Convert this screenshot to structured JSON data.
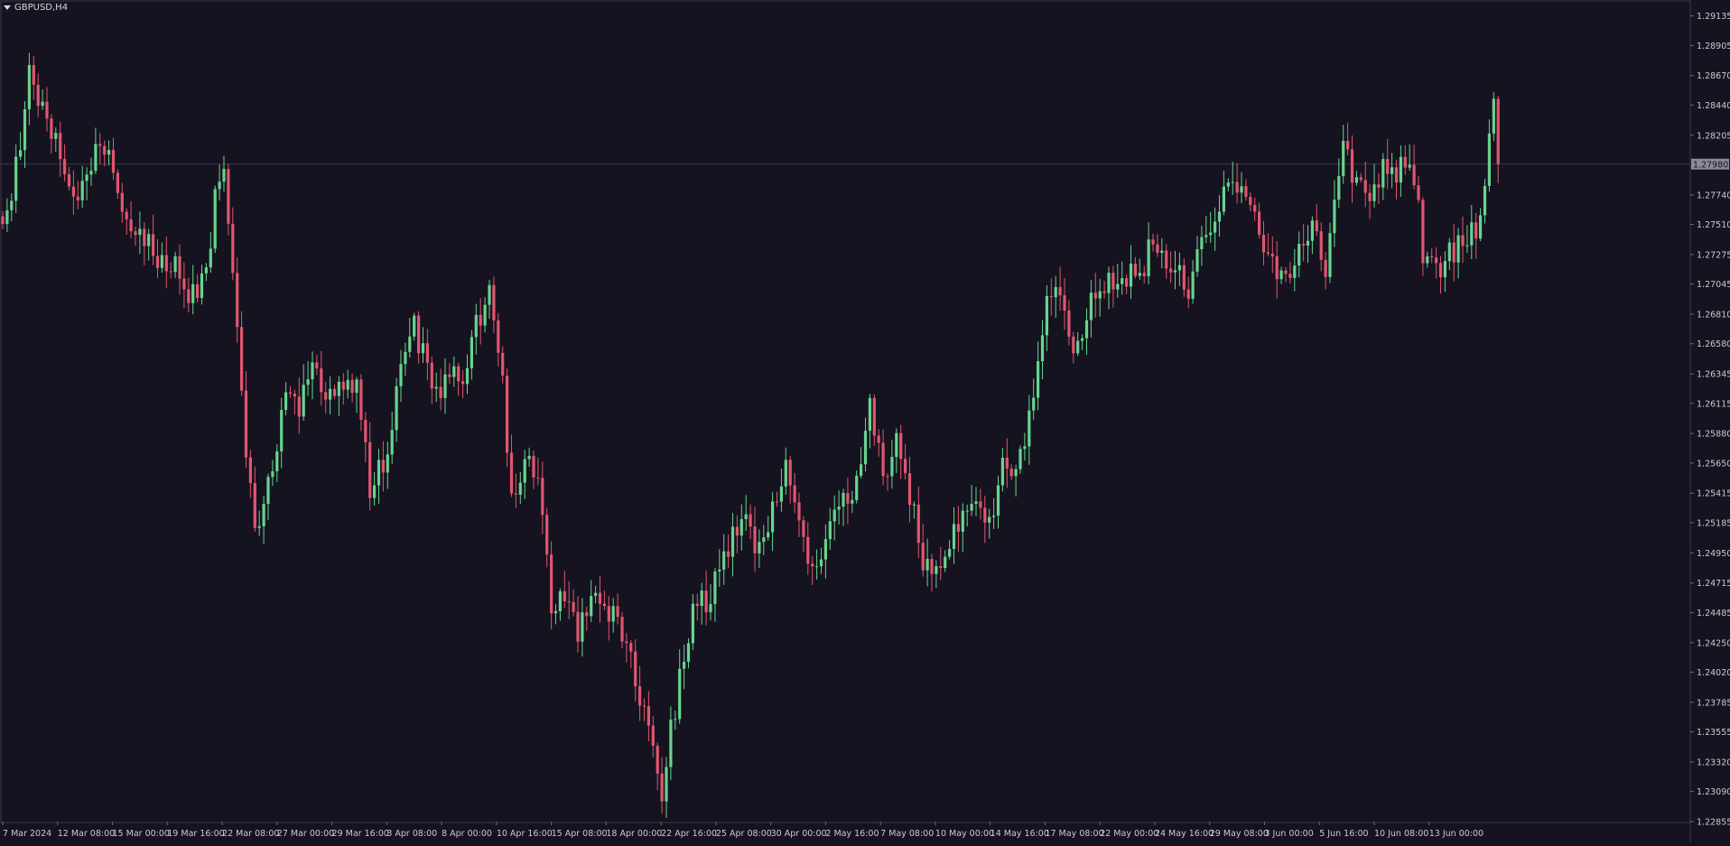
{
  "window": {
    "symbol": "GBPUSD,H4"
  },
  "chart_data": {
    "type": "candlestick",
    "symbol": "GBPUSD",
    "timeframe": "H4",
    "ylim": [
      1.22855,
      1.29245
    ],
    "y_ticks": [
      "1.29135",
      "1.28905",
      "1.28670",
      "1.28440",
      "1.28205",
      "1.27740",
      "1.27510",
      "1.27275",
      "1.27045",
      "1.26810",
      "1.26580",
      "1.26345",
      "1.26115",
      "1.25880",
      "1.25650",
      "1.25415",
      "1.25185",
      "1.24950",
      "1.24715",
      "1.24485",
      "1.24250",
      "1.24020",
      "1.23785",
      "1.23555",
      "1.23320",
      "1.23090",
      "1.22855"
    ],
    "x_ticks": [
      "7 Mar 2024",
      "12 Mar 08:00",
      "15 Mar 00:00",
      "19 Mar 16:00",
      "22 Mar 08:00",
      "27 Mar 00:00",
      "29 Mar 16:00",
      "3 Apr 08:00",
      "8 Apr 00:00",
      "10 Apr 16:00",
      "15 Apr 08:00",
      "18 Apr 00:00",
      "22 Apr 16:00",
      "25 Apr 08:00",
      "30 Apr 00:00",
      "2 May 16:00",
      "7 May 08:00",
      "10 May 00:00",
      "14 May 16:00",
      "17 May 08:00",
      "22 May 00:00",
      "24 May 16:00",
      "29 May 08:00",
      "3 Jun 00:00",
      "5 Jun 16:00",
      "10 Jun 08:00",
      "13 Jun 00:00"
    ],
    "current_price": "1.27980",
    "current_price_value": 1.2798,
    "candle_count": 339,
    "bull_color": "#67d48d",
    "bear_color": "#e0566f",
    "background": "#161320",
    "grid": false,
    "price_path": [
      [
        0,
        1.2745
      ],
      [
        4,
        1.2812
      ],
      [
        6,
        1.2865
      ],
      [
        9,
        1.2843
      ],
      [
        13,
        1.2805
      ],
      [
        16,
        1.277
      ],
      [
        20,
        1.2802
      ],
      [
        24,
        1.2818
      ],
      [
        26,
        1.2778
      ],
      [
        30,
        1.274
      ],
      [
        35,
        1.2728
      ],
      [
        40,
        1.2712
      ],
      [
        42,
        1.269
      ],
      [
        46,
        1.2708
      ],
      [
        48,
        1.2778
      ],
      [
        50,
        1.2788
      ],
      [
        52,
        1.2705
      ],
      [
        55,
        1.258
      ],
      [
        57,
        1.2505
      ],
      [
        60,
        1.2545
      ],
      [
        64,
        1.2625
      ],
      [
        67,
        1.2612
      ],
      [
        70,
        1.2638
      ],
      [
        73,
        1.261
      ],
      [
        76,
        1.2635
      ],
      [
        80,
        1.2625
      ],
      [
        83,
        1.2545
      ],
      [
        87,
        1.257
      ],
      [
        90,
        1.265
      ],
      [
        93,
        1.267
      ],
      [
        96,
        1.264
      ],
      [
        99,
        1.2615
      ],
      [
        102,
        1.2645
      ],
      [
        104,
        1.263
      ],
      [
        106,
        1.2665
      ],
      [
        108,
        1.268
      ],
      [
        110,
        1.2695
      ],
      [
        113,
        1.2625
      ],
      [
        115,
        1.254
      ],
      [
        118,
        1.257
      ],
      [
        121,
        1.255
      ],
      [
        124,
        1.245
      ],
      [
        127,
        1.246
      ],
      [
        130,
        1.243
      ],
      [
        133,
        1.247
      ],
      [
        136,
        1.246
      ],
      [
        139,
        1.2435
      ],
      [
        141,
        1.242
      ],
      [
        144,
        1.2385
      ],
      [
        147,
        1.2338
      ],
      [
        149,
        1.231
      ],
      [
        151,
        1.2355
      ],
      [
        153,
        1.2395
      ],
      [
        156,
        1.2455
      ],
      [
        159,
        1.2455
      ],
      [
        162,
        1.2485
      ],
      [
        165,
        1.2505
      ],
      [
        168,
        1.252
      ],
      [
        171,
        1.2495
      ],
      [
        174,
        1.2535
      ],
      [
        177,
        1.2558
      ],
      [
        179,
        1.2545
      ],
      [
        182,
        1.249
      ],
      [
        185,
        1.2482
      ],
      [
        188,
        1.2525
      ],
      [
        191,
        1.254
      ],
      [
        194,
        1.2555
      ],
      [
        196,
        1.2605
      ],
      [
        199,
        1.2555
      ],
      [
        202,
        1.258
      ],
      [
        205,
        1.254
      ],
      [
        208,
        1.2485
      ],
      [
        211,
        1.249
      ],
      [
        214,
        1.25
      ],
      [
        217,
        1.2525
      ],
      [
        220,
        1.2535
      ],
      [
        223,
        1.252
      ],
      [
        226,
        1.256
      ],
      [
        229,
        1.2558
      ],
      [
        232,
        1.2595
      ],
      [
        234,
        1.264
      ],
      [
        236,
        1.269
      ],
      [
        238,
        1.27
      ],
      [
        240,
        1.2678
      ],
      [
        242,
        1.266
      ],
      [
        244,
        1.2652
      ],
      [
        246,
        1.27
      ],
      [
        249,
        1.2708
      ],
      [
        252,
        1.2705
      ],
      [
        255,
        1.2715
      ],
      [
        258,
        1.2718
      ],
      [
        260,
        1.274
      ],
      [
        263,
        1.2725
      ],
      [
        266,
        1.2712
      ],
      [
        268,
        1.27
      ],
      [
        270,
        1.273
      ],
      [
        273,
        1.2755
      ],
      [
        276,
        1.277
      ],
      [
        278,
        1.279
      ],
      [
        280,
        1.2778
      ],
      [
        283,
        1.2755
      ],
      [
        286,
        1.273
      ],
      [
        288,
        1.2705
      ],
      [
        290,
        1.2708
      ],
      [
        293,
        1.2728
      ],
      [
        296,
        1.2752
      ],
      [
        299,
        1.272
      ],
      [
        301,
        1.276
      ],
      [
        303,
        1.2812
      ],
      [
        306,
        1.2778
      ],
      [
        309,
        1.277
      ],
      [
        312,
        1.2795
      ],
      [
        315,
        1.279
      ],
      [
        317,
        1.2805
      ],
      [
        319,
        1.279
      ],
      [
        321,
        1.273
      ],
      [
        324,
        1.2715
      ],
      [
        327,
        1.2728
      ],
      [
        330,
        1.2738
      ],
      [
        333,
        1.2748
      ],
      [
        335,
        1.2785
      ],
      [
        337,
        1.2855
      ],
      [
        339,
        1.28
      ],
      [
        341,
        1.2793
      ]
    ]
  }
}
